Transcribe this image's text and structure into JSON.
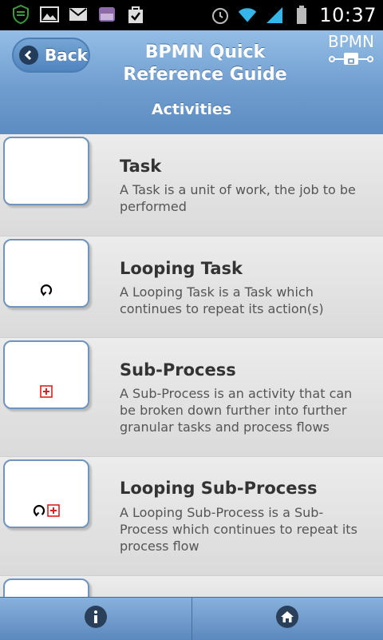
{
  "status_bar": {
    "time": "10:37",
    "icons": [
      "shield-icon",
      "image-icon",
      "gmail-icon",
      "drawer-icon",
      "checkbag-icon",
      "alarm-icon",
      "wifi-icon",
      "signal-icon",
      "battery-icon"
    ]
  },
  "header": {
    "back_label": "Back",
    "title": "BPMN Quick Reference Guide",
    "logo_text": "BPMN",
    "subtitle": "Activities"
  },
  "items": [
    {
      "title": "Task",
      "description": "A Task is a unit of work, the job to be performed",
      "markers": []
    },
    {
      "title": "Looping Task",
      "description": "A Looping Task is a Task which continues to repeat its action(s)",
      "markers": [
        "loop"
      ]
    },
    {
      "title": "Sub-Process",
      "description": "A Sub-Process is an activity that can be broken down further into further granular tasks and process flows",
      "markers": [
        "plus"
      ]
    },
    {
      "title": "Looping Sub-Process",
      "description": "A Looping Sub-Process is a Sub-Process which continues to repeat its process flow",
      "markers": [
        "loop",
        "plus"
      ]
    }
  ],
  "nav": {
    "left_icon": "info-icon",
    "right_icon": "home-icon"
  },
  "colors": {
    "header_top": "#94bee6",
    "header_bottom": "#5d8cc2",
    "subprocess_marker": "#e02020"
  }
}
